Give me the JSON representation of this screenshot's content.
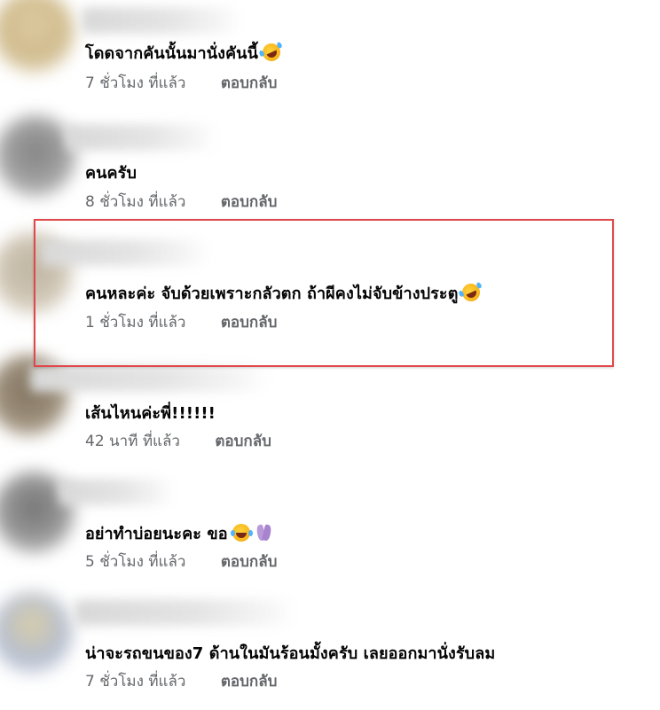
{
  "colors": {
    "highlight_border": "#e0484b",
    "meta_text": "#65676b",
    "comment_text": "#050505"
  },
  "comments": [
    {
      "text": "โดดจากคันนั้นมานั่งคันนี้",
      "emojis": [
        "rofl-emoji"
      ],
      "time": "7 ชั่วโมง ที่แล้ว",
      "reply": "ตอบกลับ"
    },
    {
      "text": "คนครับ",
      "emojis": [],
      "time": "8 ชั่วโมง ที่แล้ว",
      "reply": "ตอบกลับ"
    },
    {
      "text": "คนหละค่ะ จับด้วยเพราะกลัวตก ถ้าผีคงไม่จับข้างประตู",
      "emojis": [
        "rofl-emoji"
      ],
      "time": "1 ชั่วโมง ที่แล้ว",
      "reply": "ตอบกลับ",
      "highlighted": true
    },
    {
      "text": "เส้นไหนค่ะพี่!!!!!!",
      "emojis": [],
      "time": "42 นาที ที่แล้ว",
      "reply": "ตอบกลับ"
    },
    {
      "text": "อย่าทำบ่อยนะคะ ขอ",
      "emojis": [
        "tears-of-joy-emoji",
        "praying-hands-emoji"
      ],
      "time": "5 ชั่วโมง ที่แล้ว",
      "reply": "ตอบกลับ"
    },
    {
      "text": "น่าจะรถขนของ7 ด้านในมันร้อนมั้งครับ เลยออกมานั่งรับลม",
      "emojis": [],
      "time": "7 ชั่วโมง ที่แล้ว",
      "reply": "ตอบกลับ"
    }
  ]
}
